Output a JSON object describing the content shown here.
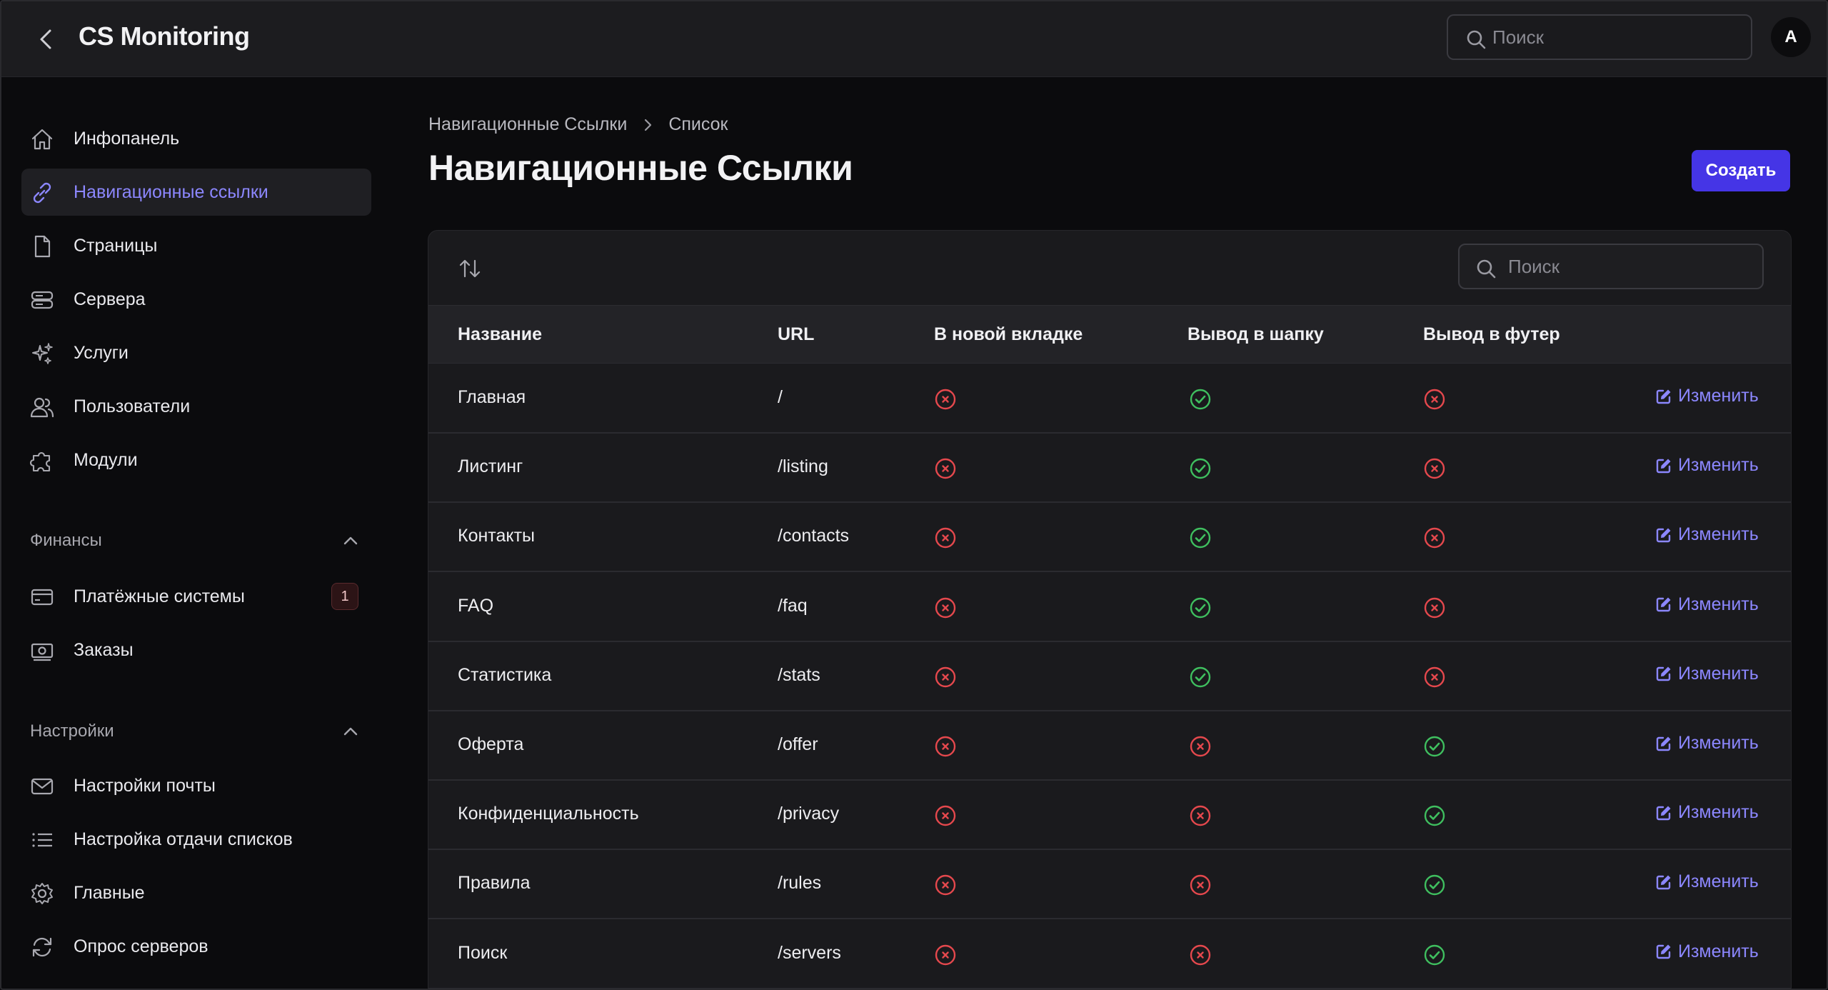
{
  "app": {
    "title": "CS Monitoring"
  },
  "header": {
    "search_placeholder": "Поиск",
    "avatar_initial": "A"
  },
  "sidebar": {
    "items": [
      {
        "label": "Инфопанель",
        "icon": "home-icon"
      },
      {
        "label": "Навигационные ссылки",
        "icon": "link-icon",
        "active": true
      },
      {
        "label": "Страницы",
        "icon": "page-icon"
      },
      {
        "label": "Сервера",
        "icon": "server-icon"
      },
      {
        "label": "Услуги",
        "icon": "sparkles-icon"
      },
      {
        "label": "Пользователи",
        "icon": "users-icon"
      },
      {
        "label": "Модули",
        "icon": "puzzle-icon"
      }
    ],
    "groups": [
      {
        "label": "Финансы",
        "expanded": true,
        "items": [
          {
            "label": "Платёжные системы",
            "icon": "credit-card-icon",
            "badge": "1"
          },
          {
            "label": "Заказы",
            "icon": "cash-icon"
          }
        ]
      },
      {
        "label": "Настройки",
        "expanded": true,
        "items": [
          {
            "label": "Настройки почты",
            "icon": "mail-icon"
          },
          {
            "label": "Настройка отдачи списков",
            "icon": "list-icon"
          },
          {
            "label": "Главные",
            "icon": "gear-icon"
          },
          {
            "label": "Опрос серверов",
            "icon": "refresh-icon"
          }
        ]
      }
    ]
  },
  "breadcrumb": [
    "Навигационные Ссылки",
    "Список"
  ],
  "page": {
    "title": "Навигационные Ссылки",
    "create_label": "Создать"
  },
  "table": {
    "search_placeholder": "Поиск",
    "columns": [
      "Название",
      "URL",
      "В новой вкладке",
      "Вывод в шапку",
      "Вывод в футер"
    ],
    "edit_label": "Изменить",
    "rows": [
      {
        "name": "Главная",
        "url": "/",
        "new_tab": false,
        "header": true,
        "footer": false
      },
      {
        "name": "Листинг",
        "url": "/listing",
        "new_tab": false,
        "header": true,
        "footer": false
      },
      {
        "name": "Контакты",
        "url": "/contacts",
        "new_tab": false,
        "header": true,
        "footer": false
      },
      {
        "name": "FAQ",
        "url": "/faq",
        "new_tab": false,
        "header": true,
        "footer": false
      },
      {
        "name": "Статистика",
        "url": "/stats",
        "new_tab": false,
        "header": true,
        "footer": false
      },
      {
        "name": "Оферта",
        "url": "/offer",
        "new_tab": false,
        "header": false,
        "footer": true
      },
      {
        "name": "Конфиденциальность",
        "url": "/privacy",
        "new_tab": false,
        "header": false,
        "footer": true
      },
      {
        "name": "Правила",
        "url": "/rules",
        "new_tab": false,
        "header": false,
        "footer": true
      },
      {
        "name": "Поиск",
        "url": "/servers",
        "new_tab": false,
        "header": false,
        "footer": true
      }
    ]
  },
  "colors": {
    "accent": "#4535e6",
    "active_link": "#8c87ff",
    "status_yes": "#3fbf5f",
    "status_no": "#e5484d"
  }
}
